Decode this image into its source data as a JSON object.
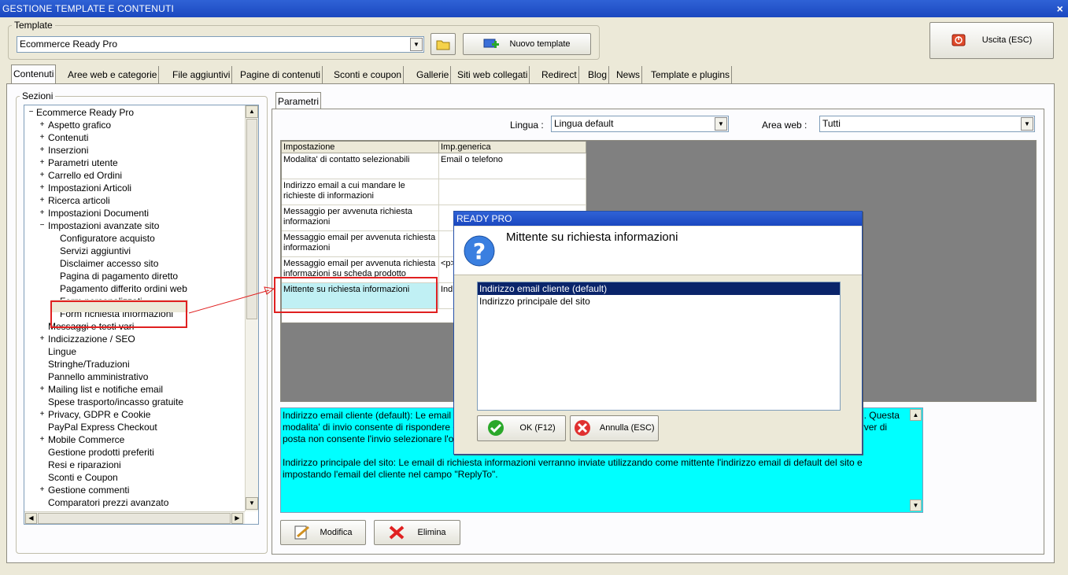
{
  "window": {
    "title": "GESTIONE TEMPLATE E CONTENUTI",
    "close": "×"
  },
  "template": {
    "group_label": "Template",
    "selected": "Ecommerce Ready Pro",
    "new_button": "Nuovo template",
    "exit_button": "Uscita (ESC)"
  },
  "tabs": [
    "Contenuti",
    "Aree web e categorie",
    "File aggiuntivi",
    "Pagine di contenuti",
    "Sconti e coupon",
    "Gallerie",
    "Siti web collegati",
    "Redirect",
    "Blog",
    "News",
    "Template e plugins"
  ],
  "sections": {
    "label": "Sezioni",
    "root": "Ecommerce Ready Pro",
    "items": [
      "Aspetto grafico",
      "Contenuti",
      "Inserzioni",
      "Parametri utente",
      "Carrello ed Ordini",
      "Impostazioni Articoli",
      "Ricerca articoli",
      "Impostazioni Documenti",
      "Impostazioni avanzate sito"
    ],
    "subitems": [
      "Configuratore acquisto",
      "Servizi aggiuntivi",
      "Disclaimer accesso sito",
      "Pagina di pagamento diretto",
      "Pagamento differito ordini web",
      "Form personalizzati",
      "Form richiesta informazioni"
    ],
    "items2": [
      "Messaggi e testi vari",
      "Indicizzazione / SEO",
      "Lingue",
      "Stringhe/Traduzioni",
      "Pannello amministrativo",
      "Mailing list e notifiche email",
      "Spese trasporto/incasso gratuite",
      "Privacy, GDPR e Cookie",
      "PayPal Express Checkout",
      "Mobile Commerce",
      "Gestione prodotti preferiti",
      "Resi e riparazioni",
      "Sconti e Coupon",
      "Gestione commenti",
      "Comparatori prezzi avanzato"
    ]
  },
  "params": {
    "tab": "Parametri",
    "lingua_label": "Lingua :",
    "lingua_value": "Lingua default",
    "area_label": "Area web :",
    "area_value": "Tutti",
    "col1": "Impostazione",
    "col2": "Imp.generica",
    "rows": [
      {
        "name": "Modalita' di contatto selezionabili",
        "value": "Email o telefono"
      },
      {
        "name": "Indirizzo email a cui mandare le richieste di informazioni",
        "value": ""
      },
      {
        "name": "Messaggio per avvenuta richiesta informazioni",
        "value": ""
      },
      {
        "name": "Messaggio email per avvenuta richiesta informazioni",
        "value": ""
      },
      {
        "name": "Messaggio email per avvenuta richiesta informazioni su scheda prodotto",
        "value": "<p><p"
      },
      {
        "name": "Mittente su richiesta informazioni",
        "value": "Indi"
      }
    ],
    "desc_p1": "Indirizzo email cliente (default): Le email di richiesta informazioni verranno inviate utilizzando come mittente l'indirizzo email del cliente. N.B. Questa modalita' di invio consente di rispondere direttamente al cliente ma potrebbe non essere accettata da alcuni server di posta. Se il vostro server di posta non consente l'invio selezionare l'opzione Indirizzo principale del sito.",
    "desc_p2": "Indirizzo principale del sito: Le email di richiesta informazioni verranno inviate utilizzando come mittente l'indirizzo email di default del sito e impostando l'email del cliente nel campo \"ReplyTo\".",
    "modify_button": "Modifica",
    "delete_button": "Elimina"
  },
  "dialog": {
    "title": "READY PRO",
    "heading": "Mittente su richiesta informazioni",
    "options": [
      "Indirizzo email cliente (default)",
      "Indirizzo principale del sito"
    ],
    "ok": "OK (F12)",
    "cancel": "Annulla (ESC)"
  }
}
